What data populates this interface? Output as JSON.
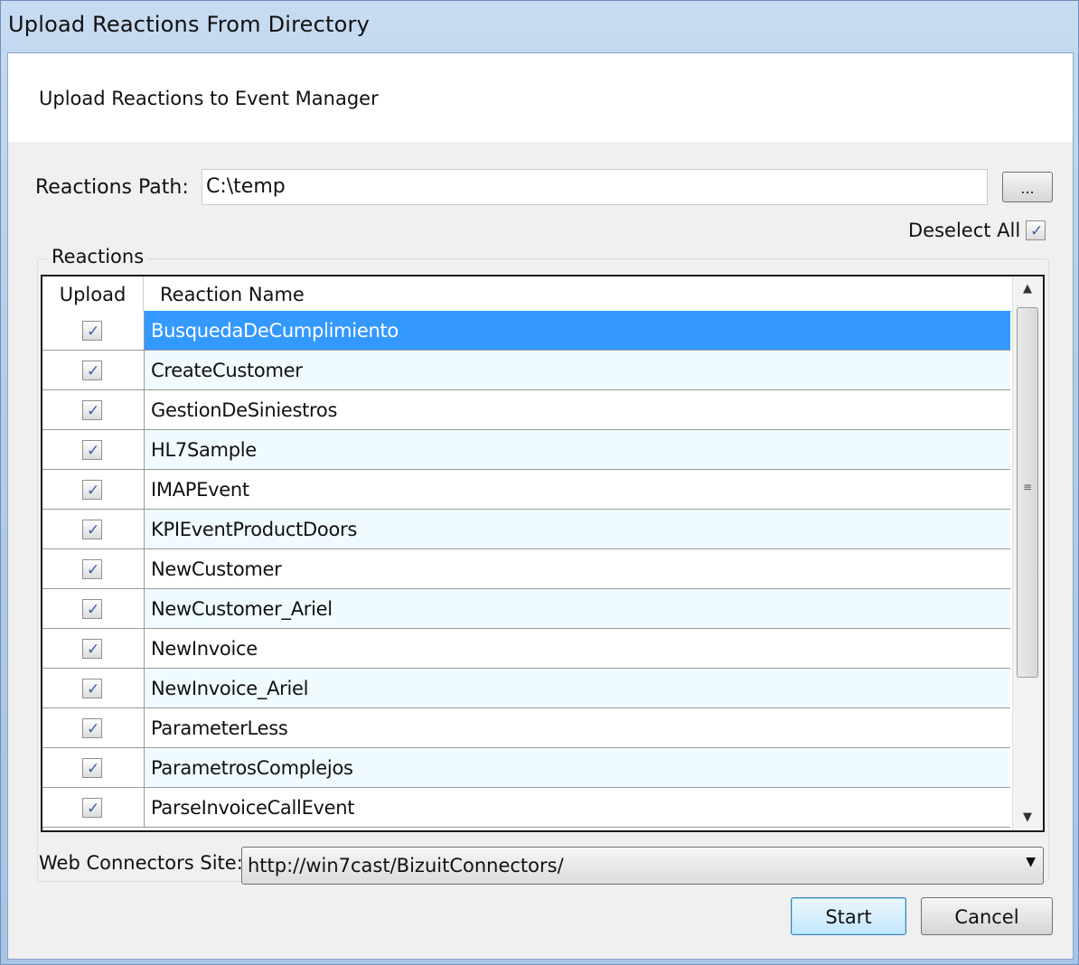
{
  "window": {
    "title": "Upload Reactions From Directory"
  },
  "header": {
    "text": "Upload Reactions to Event Manager"
  },
  "path": {
    "label": "Reactions Path:",
    "value": "C:\\temp",
    "browse_label": "..."
  },
  "deselect": {
    "label": "Deselect All",
    "checked": true
  },
  "reactions": {
    "group_label": "Reactions",
    "columns": [
      "Upload",
      "Reaction Name"
    ],
    "rows": [
      {
        "name": "BusquedaDeCumplimiento",
        "checked": true
      },
      {
        "name": "CreateCustomer",
        "checked": true
      },
      {
        "name": "GestionDeSiniestros",
        "checked": true
      },
      {
        "name": "HL7Sample",
        "checked": true
      },
      {
        "name": "IMAPEvent",
        "checked": true
      },
      {
        "name": "KPIEventProductDoors",
        "checked": true
      },
      {
        "name": "NewCustomer",
        "checked": true
      },
      {
        "name": "NewCustomer_Ariel",
        "checked": true
      },
      {
        "name": "NewInvoice",
        "checked": true
      },
      {
        "name": "NewInvoice_Ariel",
        "checked": true
      },
      {
        "name": "ParameterLess",
        "checked": true
      },
      {
        "name": "ParametrosComplejos",
        "checked": true
      },
      {
        "name": "ParseInvoiceCallEvent",
        "checked": true
      }
    ],
    "selected_index": 0
  },
  "connectors": {
    "label": "Web Connectors Site:",
    "value": "http://win7cast/BizuitConnectors/"
  },
  "buttons": {
    "start": "Start",
    "cancel": "Cancel"
  },
  "icons": {
    "checkmark": "checkmark-icon",
    "scroll_up": "scroll-up-arrow-icon",
    "scroll_down": "scroll-down-arrow-icon",
    "dropdown": "dropdown-arrow-icon"
  },
  "colors": {
    "selection": "#3399ff",
    "alt_row": "#f0fbff",
    "check": "#3a5fa8"
  }
}
